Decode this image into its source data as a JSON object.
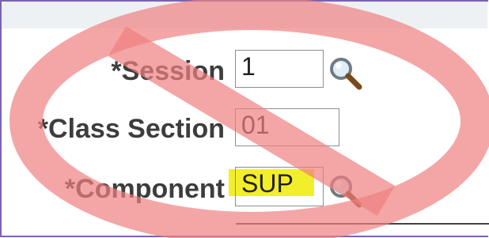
{
  "form": {
    "session": {
      "label": "*Session",
      "value": "1"
    },
    "class_section": {
      "label": "*Class Section",
      "value": "01"
    },
    "component": {
      "label": "*Component",
      "value": "SUP"
    }
  },
  "icons": {
    "lookup": "magnifier-icon",
    "overlay": "prohibition-sign-icon"
  },
  "colors": {
    "frame_border": "#7b63b3",
    "prohibition": "#f08080",
    "highlight": "#f2ee2a",
    "label_text": "#3d3d3d"
  }
}
